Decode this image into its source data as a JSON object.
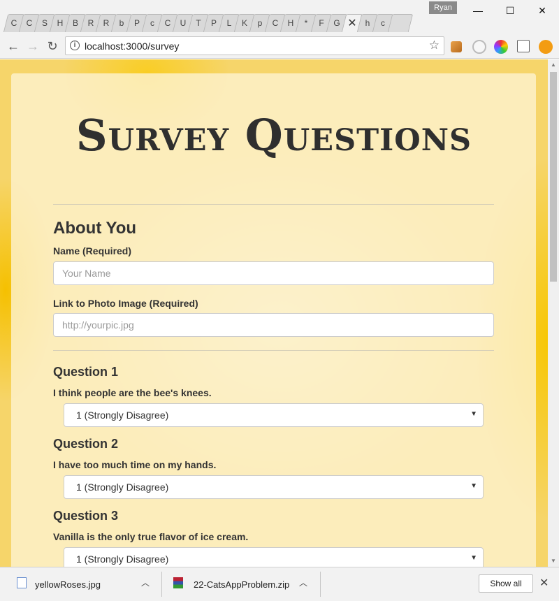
{
  "browser": {
    "tabs": [
      "C",
      "C",
      "S",
      "H",
      "B",
      "R",
      "R",
      "b",
      "P",
      "c",
      "C",
      "U",
      "T",
      "P",
      "L",
      "K",
      "p",
      "C",
      "H",
      "*",
      "F",
      "G",
      "✕",
      "h",
      "c"
    ],
    "profile_name": "Ryan",
    "window_controls": [
      "—",
      "☐",
      "✕"
    ],
    "url": "localhost:3000/survey"
  },
  "page": {
    "title": "Survey Questions",
    "about": {
      "heading": "About You",
      "name_label": "Name (Required)",
      "name_placeholder": "Your Name",
      "photo_label": "Link to Photo Image (Required)",
      "photo_placeholder": "http://yourpic.jpg"
    },
    "questions": [
      {
        "heading": "Question 1",
        "text": "I think people are the bee's knees.",
        "selected": "1 (Strongly Disagree)"
      },
      {
        "heading": "Question 2",
        "text": "I have too much time on my hands.",
        "selected": "1 (Strongly Disagree)"
      },
      {
        "heading": "Question 3",
        "text": "Vanilla is the only true flavor of ice cream.",
        "selected": "1 (Strongly Disagree)"
      }
    ]
  },
  "downloads": {
    "items": [
      {
        "name": "yellowRoses.jpg"
      },
      {
        "name": "22-CatsAppProblem.zip"
      }
    ],
    "show_all_label": "Show all"
  },
  "colors": {
    "panel": "#fcf1cd",
    "background_yellow": "#f6d56a",
    "title_text": "#2f2f2f"
  }
}
